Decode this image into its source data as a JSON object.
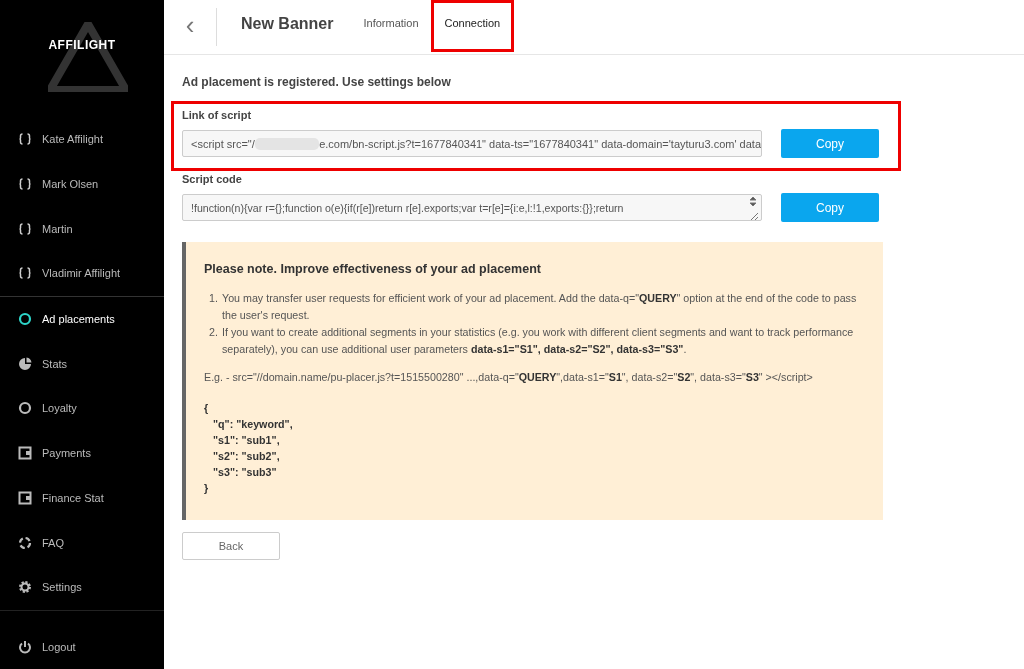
{
  "sidebar": {
    "logo": "AFFILIGHT",
    "groups": [
      [
        {
          "label": "Kate Affilight",
          "kind": "braces",
          "selected": false
        },
        {
          "label": "Mark Olsen",
          "kind": "braces",
          "selected": false
        },
        {
          "label": "Martin",
          "kind": "braces",
          "selected": false
        },
        {
          "label": "Vladimir Affilight",
          "kind": "braces",
          "selected": false
        }
      ],
      [
        {
          "label": "Ad placements",
          "kind": "ring",
          "selected": true
        },
        {
          "label": "Stats",
          "kind": "pie",
          "selected": false
        },
        {
          "label": "Loyalty",
          "kind": "ring",
          "selected": false
        },
        {
          "label": "Payments",
          "kind": "wallet",
          "selected": false
        },
        {
          "label": "Finance Stat",
          "kind": "wallet",
          "selected": false
        },
        {
          "label": "FAQ",
          "kind": "faq",
          "selected": false
        },
        {
          "label": "Settings",
          "kind": "gear",
          "selected": false
        }
      ],
      [
        {
          "label": "Logout",
          "kind": "power",
          "selected": false
        }
      ]
    ]
  },
  "header": {
    "back": "‹",
    "title": "New Banner",
    "tabs": [
      {
        "label": "Information",
        "selected": false,
        "highlighted": false
      },
      {
        "label": "Connection",
        "selected": true,
        "highlighted": true
      }
    ]
  },
  "intro": "Ad placement is registered. Use settings below",
  "link_section": {
    "label": "Link of script",
    "highlighted": true,
    "value_start": "<script src=\"/",
    "value_end": "e.com/bn-script.js?t=1677840341\" data-ts=\"1677840341\" data-domain='tayturu3.com' data",
    "button": "Copy"
  },
  "code_section": {
    "label": "Script code",
    "value": "!function(n){var r={};function o(e){if(r[e])return r[e].exports;var t=r[e]={i:e,l:!1,exports:{}};return",
    "button": "Copy"
  },
  "note": {
    "title": "Please note. Improve effectiveness of your ad placement",
    "items": [
      {
        "number": "1.",
        "text": "You may transfer user requests for efficient work of your ad placement. Add the data-q=\"**QUERY**\" option at the end of the code to pass the user's request."
      },
      {
        "number": "2.",
        "text": "If you want to create additional segments in your statistics (e.g. you work with different client segments and want to track performance separately), you can use additional user parameters **data-s1=\"S1\", data-s2=\"S2\", data-s3=\"S3\"**."
      }
    ],
    "example": "E.g. - src=\"//domain.name/pu-placer.js?t=1515500280\" ...,data-q=\"**QUERY**\",data-s1=\"**S1**\", data-s2=\"**S2**\", data-s3=\"**S3**\" ></script>",
    "code_lines": [
      "{",
      "\"q\": \"keyword\",",
      "\"s1\": \"sub1\",",
      "\"s2\": \"sub2\",",
      "\"s3\": \"sub3\"",
      "}"
    ]
  },
  "back_button": "Back"
}
